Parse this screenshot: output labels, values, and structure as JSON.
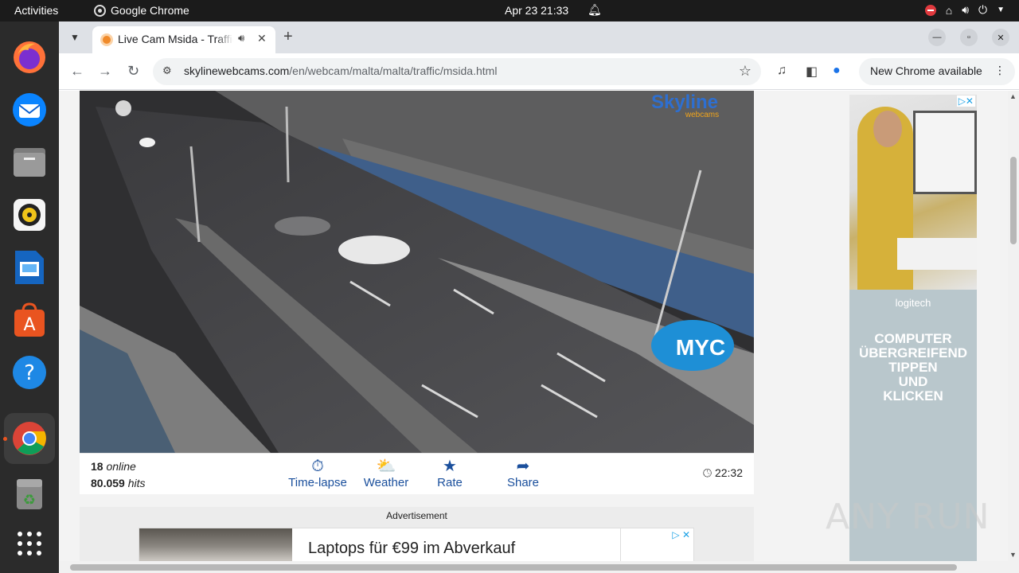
{
  "system": {
    "activities": "Activities",
    "app_name": "Google Chrome",
    "datetime": "Apr 23  21:33"
  },
  "dock": {
    "items": [
      "firefox-icon",
      "thunderbird-icon",
      "files-icon",
      "rhythmbox-icon",
      "writer-icon",
      "software-icon",
      "help-icon",
      "chrome-icon",
      "trash-icon",
      "apps-grid-icon"
    ]
  },
  "browser": {
    "tab_title": "Live Cam Msida - Traffic",
    "url_host": "skylinewebcams.com",
    "url_path": "/en/webcam/malta/malta/traffic/msida.html",
    "new_chrome_label": "New Chrome available"
  },
  "cam": {
    "logo": "Skyline",
    "logo_sub": "webcams",
    "sponsor": "MYC",
    "online_count": "18",
    "online_label": "online",
    "hits_count": "80.059",
    "hits_label": "hits",
    "actions": [
      "Time-lapse",
      "Weather",
      "Rate",
      "Share"
    ],
    "time": "22:32"
  },
  "ads": {
    "label": "Advertisement",
    "banner_text": "Laptops für €99 im Abverkauf",
    "side_brand": "logitech",
    "side_copy": [
      "COMPUTER",
      "ÜBERGREIFEND",
      "TIPPEN",
      "UND",
      "KLICKEN"
    ]
  },
  "watermark": "ANY RUN",
  "colors": {
    "link": "#1a4f9c",
    "accent": "#e95420"
  }
}
